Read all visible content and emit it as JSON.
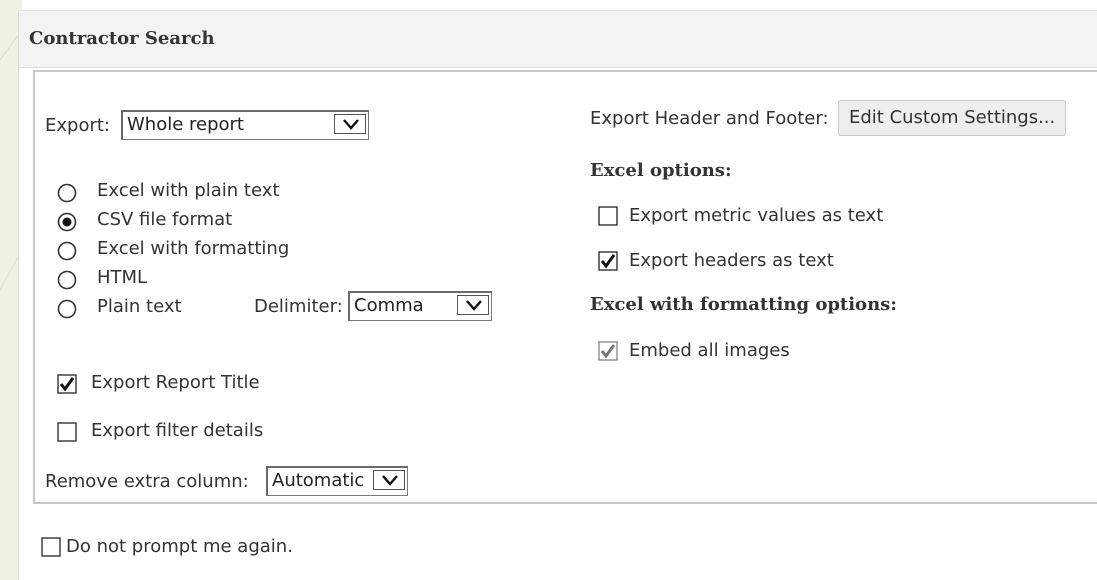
{
  "dialog": {
    "title": "Contractor Search"
  },
  "export": {
    "label": "Export:",
    "selected": "Whole report"
  },
  "formats": [
    {
      "label": "Excel with plain text",
      "selected": false
    },
    {
      "label": "CSV file format",
      "selected": true
    },
    {
      "label": "Excel with formatting",
      "selected": false
    },
    {
      "label": "HTML",
      "selected": false
    },
    {
      "label": "Plain text",
      "selected": false
    }
  ],
  "delimiter": {
    "label": "Delimiter:",
    "selected": "Comma"
  },
  "options": {
    "export_report_title": {
      "label": "Export Report Title",
      "checked": true
    },
    "export_filter_details": {
      "label": "Export filter details",
      "checked": false
    }
  },
  "remove_extra_column": {
    "label": "Remove extra column:",
    "selected": "Automatic"
  },
  "header_footer": {
    "label": "Export Header and Footer:",
    "button": "Edit Custom Settings..."
  },
  "excel_options": {
    "heading": "Excel options:",
    "metric_values_as_text": {
      "label": "Export metric values as text",
      "checked": false
    },
    "headers_as_text": {
      "label": "Export headers as text",
      "checked": true
    }
  },
  "excel_formatting_options": {
    "heading": "Excel with formatting options:",
    "embed_all_images": {
      "label": "Embed all images",
      "checked": true,
      "disabled": true
    }
  },
  "footer": {
    "do_not_prompt": {
      "label": "Do not prompt me again.",
      "checked": false
    }
  },
  "colors": {
    "title_bar": "#f3f3f3",
    "panel_border": "#c8c8c8",
    "text": "#333333",
    "button_bg": "#eeeeee"
  }
}
